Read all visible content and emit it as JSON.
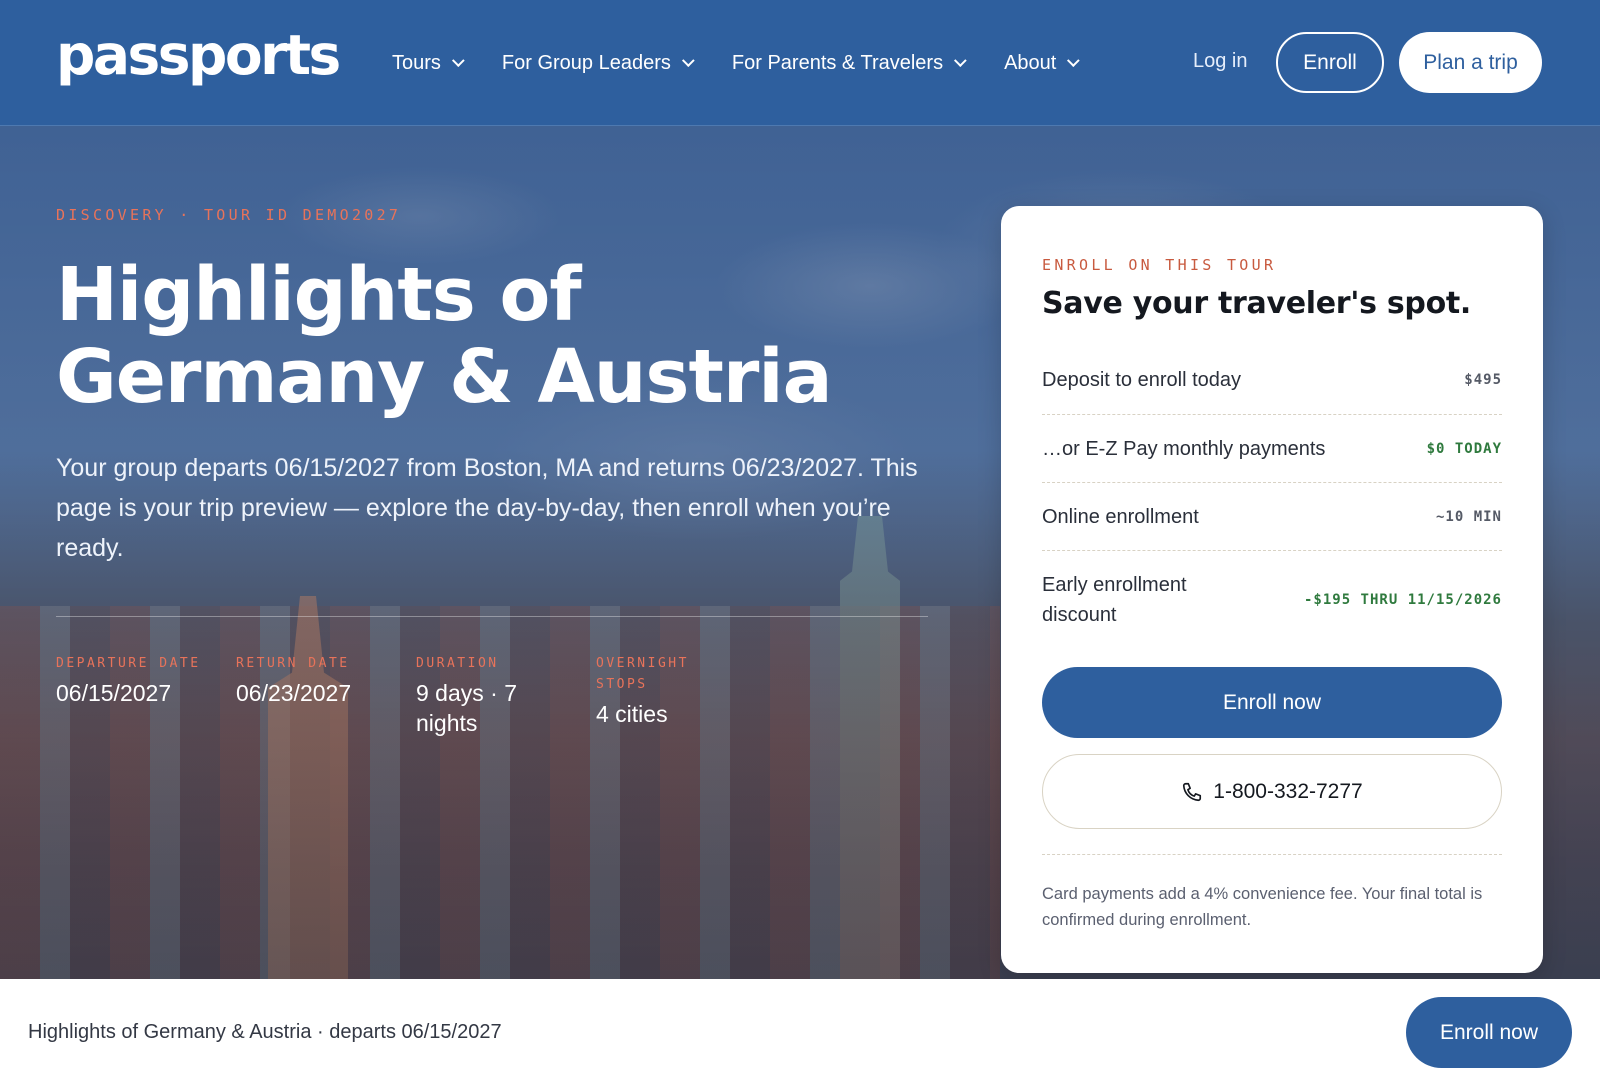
{
  "nav": {
    "logo": "passports",
    "items": [
      {
        "label": "Tours"
      },
      {
        "label": "For Group Leaders"
      },
      {
        "label": "For Parents & Travelers"
      },
      {
        "label": "About"
      }
    ],
    "login": "Log in",
    "enroll": "Enroll",
    "plan": "Plan a trip"
  },
  "hero": {
    "eyebrow": "DISCOVERY · TOUR ID DEMO2027",
    "title_line1": "Highlights of",
    "title_line2": "Germany & Austria",
    "description": "Your group departs 06/15/2027 from Boston, MA and returns 06/23/2027. This page is your trip preview — explore the day-by-day, then enroll when you’re ready.",
    "stats": [
      {
        "label": "DEPARTURE DATE",
        "value": "06/15/2027"
      },
      {
        "label": "RETURN DATE",
        "value": "06/23/2027"
      },
      {
        "label": "DURATION",
        "value": "9 days · 7 nights"
      },
      {
        "label": "OVERNIGHT STOPS",
        "value": "4 cities"
      }
    ]
  },
  "card": {
    "eyebrow": "ENROLL ON THIS TOUR",
    "title": "Save your traveler's spot.",
    "rows": [
      {
        "label": "Deposit to enroll today",
        "value": "$495"
      },
      {
        "label": "…or E-Z Pay monthly payments",
        "value": "$0 TODAY"
      },
      {
        "label": "Online enrollment",
        "value": "~10 MIN"
      },
      {
        "label": "Early enrollment discount",
        "value": "-$195 THRU 11/15/2026"
      }
    ],
    "enroll_button": "Enroll now",
    "phone": "1-800-332-7277",
    "note": "Card payments add a 4% convenience fee. Your final total is confirmed during enrollment."
  },
  "footer": {
    "summary": "Highlights of Germany & Austria · departs 06/15/2027",
    "enroll_button": "Enroll now"
  },
  "colors": {
    "brand_blue": "#2e5f9e",
    "accent_coral": "#e8735a",
    "discount_green": "#2f7a3e"
  },
  "icons": {
    "chevron": "chevron-down-icon",
    "phone": "phone-icon"
  }
}
